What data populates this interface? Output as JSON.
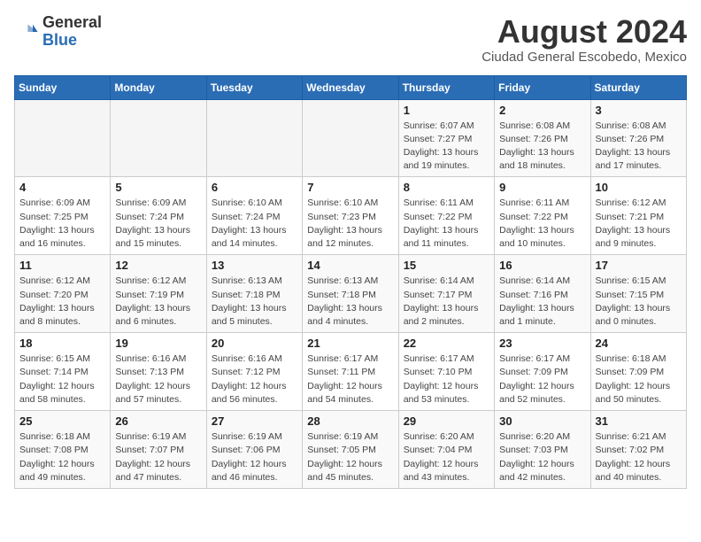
{
  "logo": {
    "general": "General",
    "blue": "Blue"
  },
  "header": {
    "month_year": "August 2024",
    "location": "Ciudad General Escobedo, Mexico"
  },
  "days_of_week": [
    "Sunday",
    "Monday",
    "Tuesday",
    "Wednesday",
    "Thursday",
    "Friday",
    "Saturday"
  ],
  "weeks": [
    [
      {
        "day": "",
        "info": ""
      },
      {
        "day": "",
        "info": ""
      },
      {
        "day": "",
        "info": ""
      },
      {
        "day": "",
        "info": ""
      },
      {
        "day": "1",
        "info": "Sunrise: 6:07 AM\nSunset: 7:27 PM\nDaylight: 13 hours\nand 19 minutes."
      },
      {
        "day": "2",
        "info": "Sunrise: 6:08 AM\nSunset: 7:26 PM\nDaylight: 13 hours\nand 18 minutes."
      },
      {
        "day": "3",
        "info": "Sunrise: 6:08 AM\nSunset: 7:26 PM\nDaylight: 13 hours\nand 17 minutes."
      }
    ],
    [
      {
        "day": "4",
        "info": "Sunrise: 6:09 AM\nSunset: 7:25 PM\nDaylight: 13 hours\nand 16 minutes."
      },
      {
        "day": "5",
        "info": "Sunrise: 6:09 AM\nSunset: 7:24 PM\nDaylight: 13 hours\nand 15 minutes."
      },
      {
        "day": "6",
        "info": "Sunrise: 6:10 AM\nSunset: 7:24 PM\nDaylight: 13 hours\nand 14 minutes."
      },
      {
        "day": "7",
        "info": "Sunrise: 6:10 AM\nSunset: 7:23 PM\nDaylight: 13 hours\nand 12 minutes."
      },
      {
        "day": "8",
        "info": "Sunrise: 6:11 AM\nSunset: 7:22 PM\nDaylight: 13 hours\nand 11 minutes."
      },
      {
        "day": "9",
        "info": "Sunrise: 6:11 AM\nSunset: 7:22 PM\nDaylight: 13 hours\nand 10 minutes."
      },
      {
        "day": "10",
        "info": "Sunrise: 6:12 AM\nSunset: 7:21 PM\nDaylight: 13 hours\nand 9 minutes."
      }
    ],
    [
      {
        "day": "11",
        "info": "Sunrise: 6:12 AM\nSunset: 7:20 PM\nDaylight: 13 hours\nand 8 minutes."
      },
      {
        "day": "12",
        "info": "Sunrise: 6:12 AM\nSunset: 7:19 PM\nDaylight: 13 hours\nand 6 minutes."
      },
      {
        "day": "13",
        "info": "Sunrise: 6:13 AM\nSunset: 7:18 PM\nDaylight: 13 hours\nand 5 minutes."
      },
      {
        "day": "14",
        "info": "Sunrise: 6:13 AM\nSunset: 7:18 PM\nDaylight: 13 hours\nand 4 minutes."
      },
      {
        "day": "15",
        "info": "Sunrise: 6:14 AM\nSunset: 7:17 PM\nDaylight: 13 hours\nand 2 minutes."
      },
      {
        "day": "16",
        "info": "Sunrise: 6:14 AM\nSunset: 7:16 PM\nDaylight: 13 hours\nand 1 minute."
      },
      {
        "day": "17",
        "info": "Sunrise: 6:15 AM\nSunset: 7:15 PM\nDaylight: 13 hours\nand 0 minutes."
      }
    ],
    [
      {
        "day": "18",
        "info": "Sunrise: 6:15 AM\nSunset: 7:14 PM\nDaylight: 12 hours\nand 58 minutes."
      },
      {
        "day": "19",
        "info": "Sunrise: 6:16 AM\nSunset: 7:13 PM\nDaylight: 12 hours\nand 57 minutes."
      },
      {
        "day": "20",
        "info": "Sunrise: 6:16 AM\nSunset: 7:12 PM\nDaylight: 12 hours\nand 56 minutes."
      },
      {
        "day": "21",
        "info": "Sunrise: 6:17 AM\nSunset: 7:11 PM\nDaylight: 12 hours\nand 54 minutes."
      },
      {
        "day": "22",
        "info": "Sunrise: 6:17 AM\nSunset: 7:10 PM\nDaylight: 12 hours\nand 53 minutes."
      },
      {
        "day": "23",
        "info": "Sunrise: 6:17 AM\nSunset: 7:09 PM\nDaylight: 12 hours\nand 52 minutes."
      },
      {
        "day": "24",
        "info": "Sunrise: 6:18 AM\nSunset: 7:09 PM\nDaylight: 12 hours\nand 50 minutes."
      }
    ],
    [
      {
        "day": "25",
        "info": "Sunrise: 6:18 AM\nSunset: 7:08 PM\nDaylight: 12 hours\nand 49 minutes."
      },
      {
        "day": "26",
        "info": "Sunrise: 6:19 AM\nSunset: 7:07 PM\nDaylight: 12 hours\nand 47 minutes."
      },
      {
        "day": "27",
        "info": "Sunrise: 6:19 AM\nSunset: 7:06 PM\nDaylight: 12 hours\nand 46 minutes."
      },
      {
        "day": "28",
        "info": "Sunrise: 6:19 AM\nSunset: 7:05 PM\nDaylight: 12 hours\nand 45 minutes."
      },
      {
        "day": "29",
        "info": "Sunrise: 6:20 AM\nSunset: 7:04 PM\nDaylight: 12 hours\nand 43 minutes."
      },
      {
        "day": "30",
        "info": "Sunrise: 6:20 AM\nSunset: 7:03 PM\nDaylight: 12 hours\nand 42 minutes."
      },
      {
        "day": "31",
        "info": "Sunrise: 6:21 AM\nSunset: 7:02 PM\nDaylight: 12 hours\nand 40 minutes."
      }
    ]
  ]
}
